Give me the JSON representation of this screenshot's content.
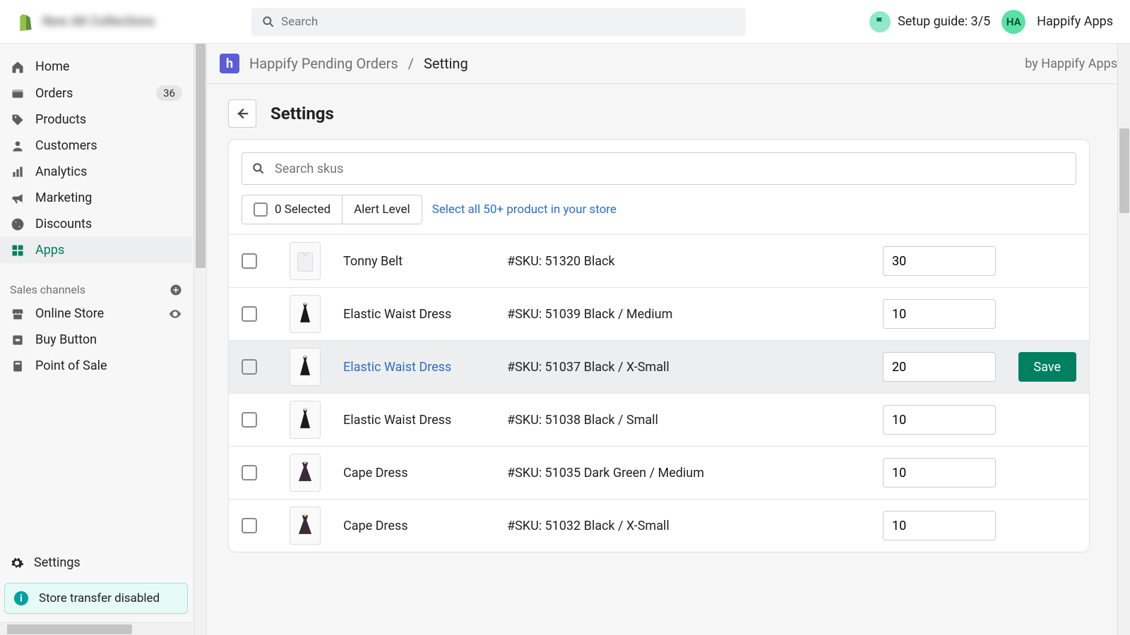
{
  "top": {
    "store_name": "New AK Collections",
    "search_placeholder": "Search",
    "setup_guide": "Setup guide: 3/5",
    "avatar_initials": "HA",
    "username": "Happify Apps"
  },
  "sidebar": {
    "items": [
      {
        "label": "Home",
        "icon": "home"
      },
      {
        "label": "Orders",
        "icon": "orders",
        "badge": "36"
      },
      {
        "label": "Products",
        "icon": "products"
      },
      {
        "label": "Customers",
        "icon": "customers"
      },
      {
        "label": "Analytics",
        "icon": "analytics"
      },
      {
        "label": "Marketing",
        "icon": "marketing"
      },
      {
        "label": "Discounts",
        "icon": "discounts"
      },
      {
        "label": "Apps",
        "icon": "apps",
        "active": true
      }
    ],
    "channels_header": "Sales channels",
    "channels": [
      {
        "label": "Online Store",
        "icon": "store",
        "has_eye": true
      },
      {
        "label": "Buy Button",
        "icon": "buy"
      },
      {
        "label": "Point of Sale",
        "icon": "pos"
      }
    ],
    "settings_label": "Settings",
    "transfer_banner": "Store transfer disabled"
  },
  "breadcrumb": {
    "app_badge": "h",
    "parent": "Happify Pending Orders",
    "sep": "/",
    "current": "Setting",
    "by": "by Happify Apps"
  },
  "page": {
    "title": "Settings",
    "sku_search_placeholder": "Search skus",
    "selected_label": "0 Selected",
    "alert_level_label": "Alert Level",
    "select_all_text": "Select all 50+ product in your store",
    "save_label": "Save"
  },
  "rows": [
    {
      "name": "Tonny Belt",
      "sku": "#SKU: 51320 Black",
      "qty": "30",
      "thumb": "shirt"
    },
    {
      "name": "Elastic Waist Dress",
      "sku": "#SKU: 51039 Black / Medium",
      "qty": "10",
      "thumb": "dress"
    },
    {
      "name": "Elastic Waist Dress",
      "sku": "#SKU: 51037 Black / X-Small",
      "qty": "20",
      "thumb": "dress",
      "hover": true,
      "link": true
    },
    {
      "name": "Elastic Waist Dress",
      "sku": "#SKU: 51038 Black / Small",
      "qty": "10",
      "thumb": "dress"
    },
    {
      "name": "Cape Dress",
      "sku": "#SKU: 51035 Dark Green / Medium",
      "qty": "10",
      "thumb": "cape"
    },
    {
      "name": "Cape Dress",
      "sku": "#SKU: 51032 Black / X-Small",
      "qty": "10",
      "thumb": "cape"
    }
  ]
}
